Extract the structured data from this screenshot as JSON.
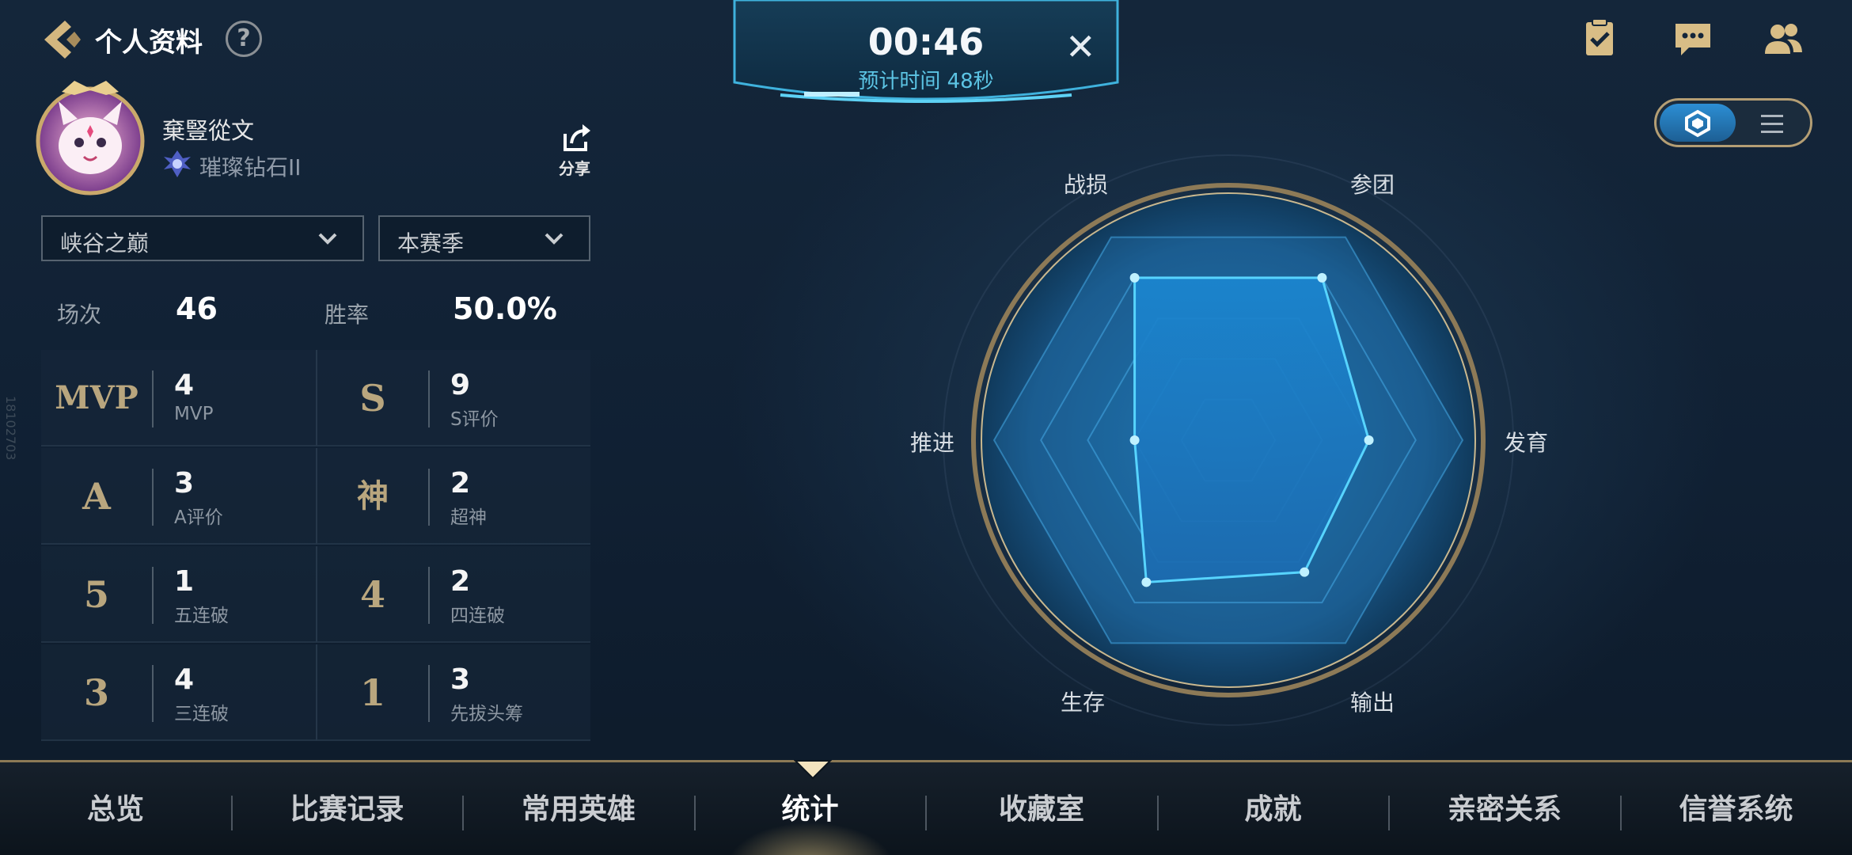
{
  "header": {
    "title": "个人资料",
    "help_glyph": "?"
  },
  "timer": {
    "time": "00:46",
    "estimate": "预计时间 48秒",
    "close_glyph": "✕"
  },
  "top_right_icons": [
    "task-icon",
    "chat-icon",
    "friends-icon"
  ],
  "profile": {
    "username": "棄豎從文",
    "rank": "璀璨钻石II",
    "share_label": "分享"
  },
  "filters": {
    "mode": "峡谷之巅",
    "season": "本赛季"
  },
  "summary": {
    "games_label": "场次",
    "games_value": "46",
    "winrate_label": "胜率",
    "winrate_value": "50.0%"
  },
  "badges": [
    {
      "icon": "MVP",
      "value": "4",
      "label": "MVP"
    },
    {
      "icon": "S",
      "value": "9",
      "label": "S评价"
    },
    {
      "icon": "A",
      "value": "3",
      "label": "A评价"
    },
    {
      "icon": "神",
      "value": "2",
      "label": "超神"
    },
    {
      "icon": "5",
      "value": "1",
      "label": "五连破"
    },
    {
      "icon": "4",
      "value": "2",
      "label": "四连破"
    },
    {
      "icon": "3",
      "value": "4",
      "label": "三连破"
    },
    {
      "icon": "1",
      "value": "3",
      "label": "先拔头筹"
    }
  ],
  "side_id": "18102703",
  "view_toggle": {
    "active": "radar",
    "options": [
      "radar-icon",
      "list-icon"
    ]
  },
  "chart_data": {
    "type": "radar",
    "axes": [
      "参团",
      "发育",
      "输出",
      "生存",
      "推进",
      "战损"
    ],
    "values": [
      0.8,
      0.6,
      0.65,
      0.7,
      0.4,
      0.8
    ],
    "max": 1.0
  },
  "tabs": [
    "总览",
    "比赛记录",
    "常用英雄",
    "统计",
    "收藏室",
    "成就",
    "亲密关系",
    "信誉系统"
  ],
  "active_tab": "统计",
  "colors": {
    "accent_gold": "#b9a67e",
    "radar_fill": "#1f8fd8",
    "radar_stroke": "#57d4ff",
    "timer_text": "#5cc4e4"
  }
}
